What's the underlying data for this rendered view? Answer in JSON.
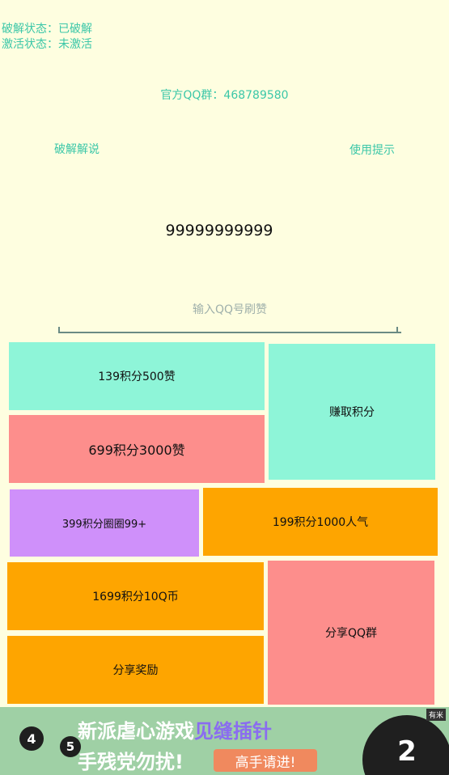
{
  "status": {
    "crack": "破解状态：已破解",
    "activation": "激活状态：未激活"
  },
  "qq_group": "官方QQ群：468789580",
  "links": {
    "crack_explain": "破解解说",
    "usage_tips": "使用提示"
  },
  "points_value": "99999999999",
  "input": {
    "placeholder": "输入QQ号刷赞",
    "value": ""
  },
  "tiles": {
    "t139": "139积分500赞",
    "earn": "赚取积分",
    "t699": "699积分3000赞",
    "t399": "399积分圈圈99+",
    "t199": "199积分1000人气",
    "t1699": "1699积分10Q币",
    "share_group": "分享QQ群",
    "share_reward": "分享奖励"
  },
  "ad": {
    "line1a": "新派虐心游戏",
    "line1b": "见缝插针",
    "line2": "手残党勿扰!",
    "button": "高手请进!",
    "tag": "有米",
    "balls": [
      "4",
      "5",
      "2"
    ]
  }
}
